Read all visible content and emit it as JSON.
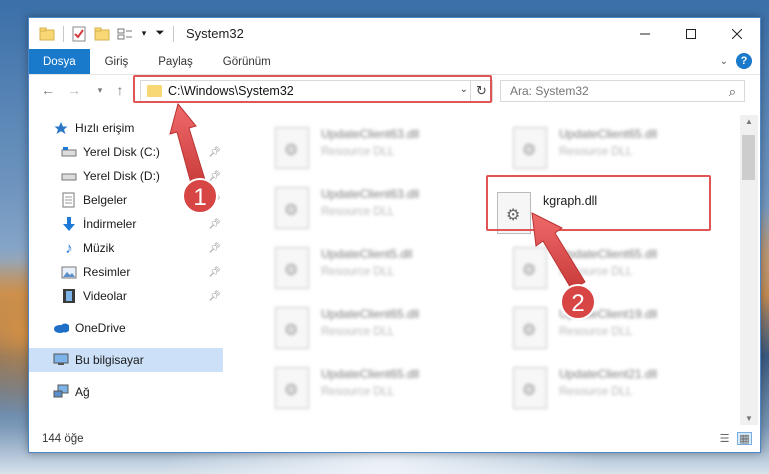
{
  "window": {
    "title": "System32"
  },
  "ribbon": {
    "tabs": [
      "Dosya",
      "Giriş",
      "Paylaş",
      "Görünüm"
    ],
    "help": "?"
  },
  "address": {
    "path": "C:\\Windows\\System32",
    "search_placeholder": "Ara: System32"
  },
  "sidebar": {
    "items": [
      {
        "label": "Hızlı erişim",
        "icon": "star-icon"
      },
      {
        "label": "Yerel Disk (C:)",
        "icon": "drive-icon"
      },
      {
        "label": "Yerel Disk (D:)",
        "icon": "drive-icon"
      },
      {
        "label": "Belgeler",
        "icon": "documents-icon"
      },
      {
        "label": "İndirmeler",
        "icon": "download-icon"
      },
      {
        "label": "Müzik",
        "icon": "music-icon"
      },
      {
        "label": "Resimler",
        "icon": "pictures-icon"
      },
      {
        "label": "Videolar",
        "icon": "videos-icon"
      },
      {
        "label": "OneDrive",
        "icon": "cloud-icon"
      },
      {
        "label": "Bu bilgisayar",
        "icon": "computer-icon"
      },
      {
        "label": "Ağ",
        "icon": "network-icon"
      }
    ]
  },
  "files": [
    {
      "name": "UpdateClient63.dll",
      "type": "Resource DLL"
    },
    {
      "name": "UpdateClient65.dll",
      "type": "Resource DLL"
    },
    {
      "name": "UpdateClient63.dll",
      "type": "Resource DLL"
    },
    {
      "name": "kgraph.dll",
      "type": ""
    },
    {
      "name": "UpdateClient5.dll",
      "type": "Resource DLL"
    },
    {
      "name": "UpdateClient65.dll",
      "type": "Resource DLL"
    },
    {
      "name": "UpdateClient65.dll",
      "type": "Resource DLL"
    },
    {
      "name": "UpdateClient19.dll",
      "type": "Resource DLL"
    },
    {
      "name": "UpdateClient65.dll",
      "type": "Resource DLL"
    },
    {
      "name": "UpdateClient21.dll",
      "type": "Resource DLL"
    }
  ],
  "status": {
    "count": "144 öğe"
  },
  "annotations": {
    "step1": "1",
    "step2": "2",
    "color": "#e05555"
  },
  "colors": {
    "accent": "#1979ca",
    "highlight": "#e05555",
    "selected": "#cce0f7"
  }
}
